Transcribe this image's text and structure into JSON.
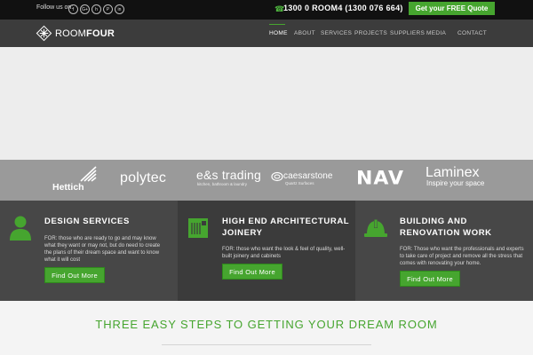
{
  "topbar": {
    "follow_label": "Follow us on:",
    "socials": [
      {
        "icon": "facebook-icon",
        "glyph": "f"
      },
      {
        "icon": "google-plus-icon",
        "glyph": "G+"
      },
      {
        "icon": "houzz-icon",
        "glyph": "h"
      },
      {
        "icon": "pinterest-icon",
        "glyph": "P"
      },
      {
        "icon": "linkedin-icon",
        "glyph": "in"
      }
    ],
    "phone": "1300 0 ROOM4 (1300 076 664)",
    "quote_label": "Get your FREE Quote"
  },
  "nav": {
    "brand_light": "ROOM",
    "brand_bold": "FOUR",
    "items": [
      "HOME",
      "ABOUT",
      "SERVICES",
      "PROJECTS",
      "SUPPLIERS",
      "MEDIA",
      "CONTACT"
    ],
    "active": "HOME"
  },
  "brands": {
    "hettich": "Hettich",
    "polytec": "polytec",
    "es": "e&s trading",
    "es_sub": "kitchen, bathroom & laundry",
    "caesarstone": "caesarstone",
    "caesarstone_sub": "Quartz Surfaces",
    "nav": "NAV",
    "laminex": "Laminex",
    "laminex_sub": "Inspire your space"
  },
  "services": [
    {
      "title": "DESIGN SERVICES",
      "description": "FOR: those who are ready to go and may know what they want or may not, but do need to create the plans of their dream space and want to know what it will cost",
      "button": "Find Out More",
      "icon": "person-icon"
    },
    {
      "title": "HIGH END ARCHITECTURAL JOINERY",
      "description": "FOR: those who want the look & feel of quality, well-built joinery and cabinets",
      "button": "Find Out More",
      "icon": "blueprint-icon"
    },
    {
      "title": "BUILDING AND RENOVATION WORK",
      "description": "FOR: Those who want the professionals and experts to take care of project and remove all the stress that comes with renovating your home.",
      "button": "Find Out More",
      "icon": "hard-hat-icon"
    }
  ],
  "steps": {
    "title": "THREE EASY STEPS TO GETTING YOUR DREAM ROOM"
  },
  "colors": {
    "accent": "#46a52f",
    "topbar": "#111111",
    "navbar": "#3c3c3c",
    "brand_strip": "#9a9a9a"
  }
}
